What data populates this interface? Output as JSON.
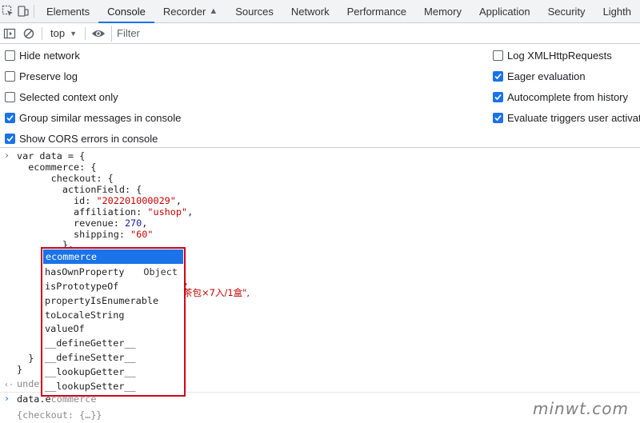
{
  "tabs": [
    "Elements",
    "Console",
    "Recorder",
    "Sources",
    "Network",
    "Performance",
    "Memory",
    "Application",
    "Security",
    "Lighth"
  ],
  "toolbar": {
    "context": "top",
    "filter_placeholder": "Filter"
  },
  "settings": {
    "left": [
      {
        "label": "Hide network",
        "checked": false
      },
      {
        "label": "Preserve log",
        "checked": false
      },
      {
        "label": "Selected context only",
        "checked": false
      },
      {
        "label": "Group similar messages in console",
        "checked": true
      },
      {
        "label": "Show CORS errors in console",
        "checked": true
      }
    ],
    "right": [
      {
        "label": "Log XMLHttpRequests",
        "checked": false
      },
      {
        "label": "Eager evaluation",
        "checked": true
      },
      {
        "label": "Autocomplete from history",
        "checked": true
      },
      {
        "label": "Evaluate triggers user activation",
        "checked": true
      }
    ]
  },
  "code": {
    "l1": "var data = {",
    "l2": "  ecommerce: {",
    "l3": "      checkout: {",
    "l4": "        actionField: {",
    "l5_key": "          id: ",
    "l5_val": "\"202201000029\"",
    "l6_key": "          affiliation: ",
    "l6_val": "\"ushop\"",
    "l7_key": "          revenue: ",
    "l7_val": "270",
    "l8_key": "          shipping: ",
    "l8_val": "\"60\"",
    "l9": "        },",
    "frag1": ",",
    "frag2": "茶包×7入/1盒\",",
    "close1": "  }",
    "close2": "}",
    "result_undef": "undef",
    "input_typed": "data.e",
    "input_ghost": "commerce",
    "eager": "{checkout: {…}}"
  },
  "autocomplete": {
    "hint": "Object",
    "items": [
      "ecommerce",
      "hasOwnProperty",
      "isPrototypeOf",
      "propertyIsEnumerable",
      "toLocaleString",
      "valueOf",
      "__defineGetter__",
      "__defineSetter__",
      "__lookupGetter__",
      "__lookupSetter__"
    ]
  },
  "watermark": "minwt.com"
}
